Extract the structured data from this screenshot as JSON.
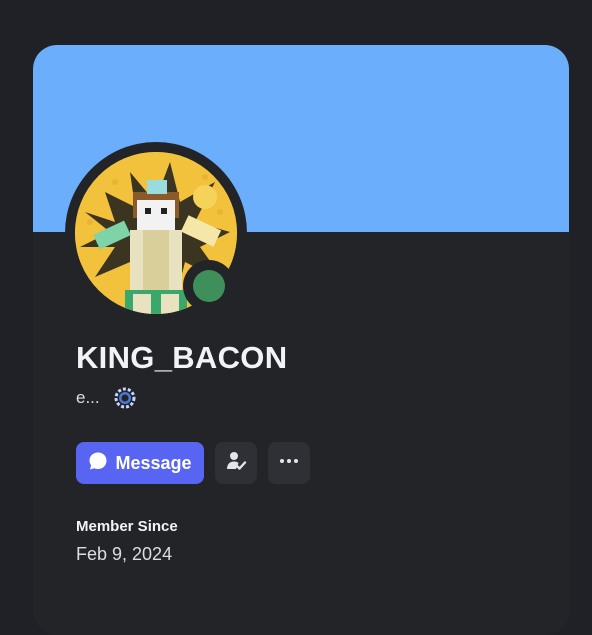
{
  "profile": {
    "username": "KING_BACON",
    "custom_status": "e...",
    "status_badge_icon": "laurel-wreath-icon",
    "online_status": "online",
    "online_color": "#3f8f5a",
    "banner_color": "#6aaefc",
    "avatar_icon": "roblox-avatar-image"
  },
  "actions": {
    "message_label": "Message",
    "message_icon": "chat-bubble-icon",
    "friend_icon": "friend-check-icon",
    "more_icon": "ellipsis-icon",
    "accent_color": "#5865f2"
  },
  "member_since": {
    "label": "Member Since",
    "date": "Feb 9, 2024"
  }
}
